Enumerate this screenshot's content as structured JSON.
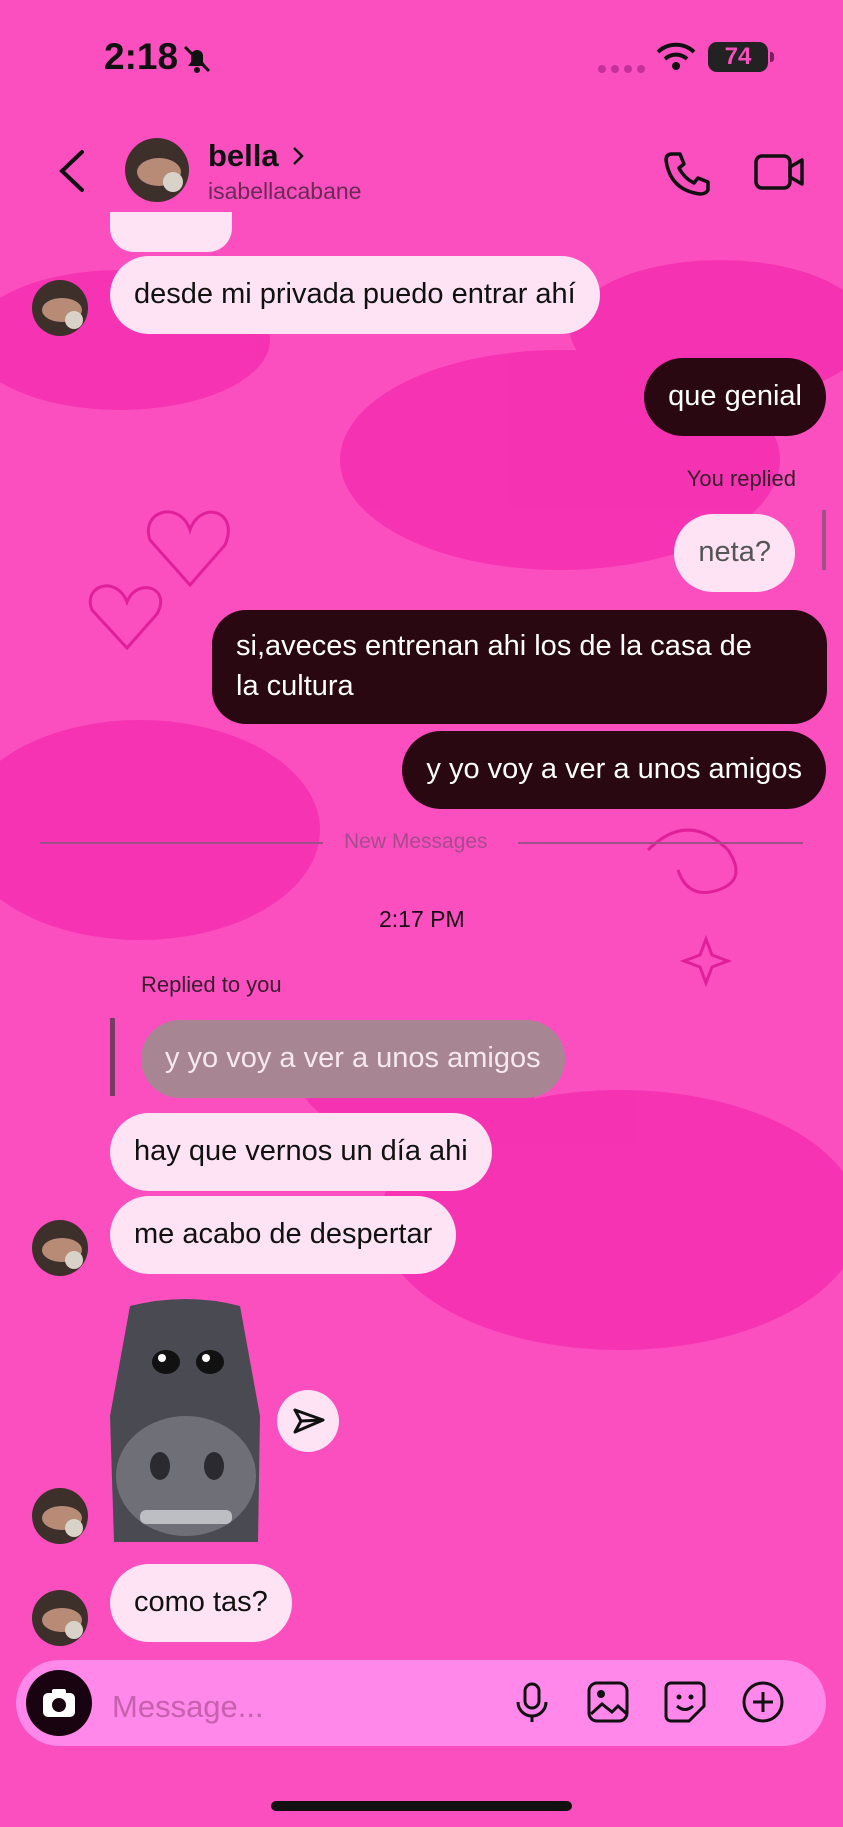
{
  "status_bar": {
    "time": "2:18",
    "battery": "74"
  },
  "header": {
    "name": "bella",
    "username": "isabellacabane"
  },
  "messages": {
    "m1": "desde mi privada puedo entrar ahí",
    "m2": "que genial",
    "you_replied_label": "You replied",
    "m3": "neta?",
    "m4_line1": "si,aveces entrenan ahi los de la casa de",
    "m4_line2": "la cultura",
    "m5": "y yo voy a ver a unos amigos",
    "new_messages_label": "New Messages",
    "timestamp": "2:17 PM",
    "replied_to_you_label": "Replied to you",
    "quoted": "y yo voy a ver a unos amigos",
    "m6": "hay que vernos un día ahi",
    "m7": "me acabo de despertar",
    "m8": "como tas?"
  },
  "composer": {
    "placeholder": "Message..."
  },
  "icons": {
    "back": "chevron-left-icon",
    "call": "phone-icon",
    "video": "video-camera-icon",
    "camera": "camera-icon",
    "mic": "microphone-icon",
    "gallery": "image-icon",
    "sticker": "sticker-icon",
    "more": "plus-circle-icon",
    "share": "send-icon"
  },
  "colors": {
    "background": "#fb4fc0",
    "incoming_bubble": "#fde3f4",
    "outgoing_bubble": "#290811"
  }
}
